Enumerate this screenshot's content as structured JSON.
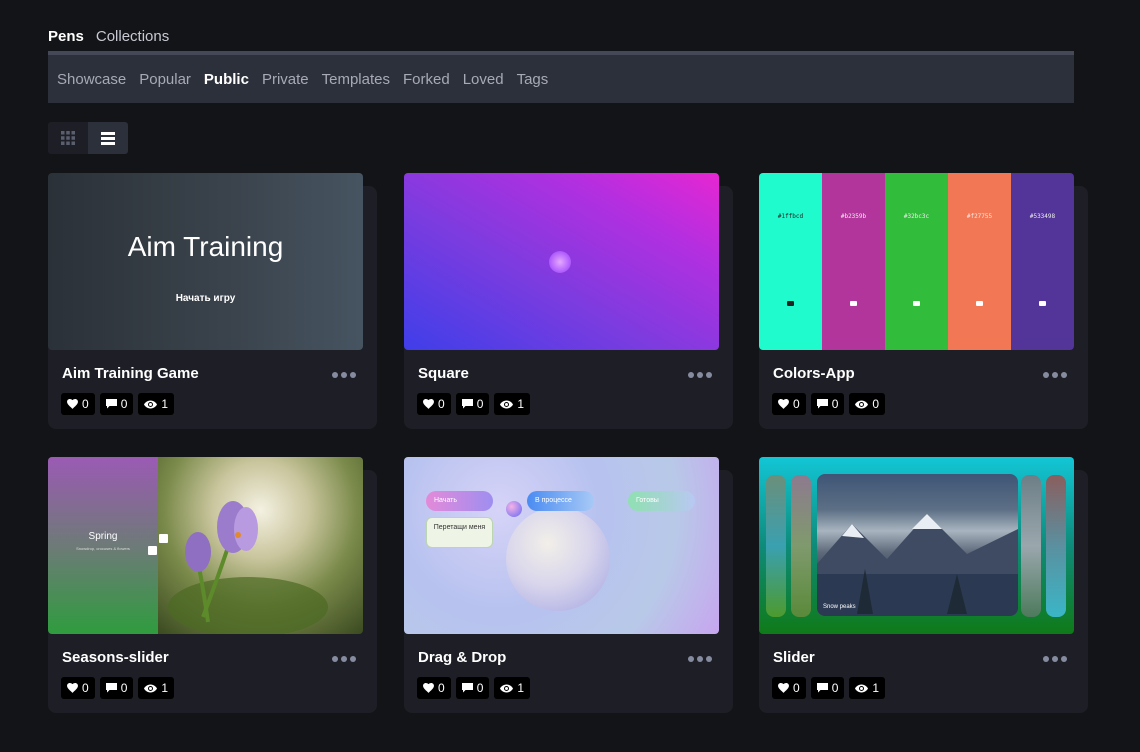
{
  "top_tabs": [
    {
      "label": "Pens",
      "active": true
    },
    {
      "label": "Collections",
      "active": false
    }
  ],
  "sub_tabs": [
    {
      "label": "Showcase"
    },
    {
      "label": "Popular"
    },
    {
      "label": "Public",
      "active": true
    },
    {
      "label": "Private"
    },
    {
      "label": "Templates"
    },
    {
      "label": "Forked"
    },
    {
      "label": "Loved"
    },
    {
      "label": "Tags"
    }
  ],
  "view_toggle": {
    "grid_icon": "grid-icon",
    "list_icon": "list-icon",
    "selected": "list"
  },
  "cards": [
    {
      "title": "Aim Training Game",
      "likes": "0",
      "comments": "0",
      "views": "1",
      "thumb": {
        "heading": "Aim Training",
        "button": "Начать игру"
      }
    },
    {
      "title": "Square",
      "likes": "0",
      "comments": "0",
      "views": "1"
    },
    {
      "title": "Colors-App",
      "likes": "0",
      "comments": "0",
      "views": "0",
      "thumb": {
        "swatches": [
          "#1ffbcd",
          "#b2359b",
          "#32bc3c",
          "#f27755",
          "#533498"
        ],
        "swatch_colors": [
          "#1ffbcd",
          "#b2359b",
          "#32bc3c",
          "#f27755",
          "#533498"
        ]
      }
    },
    {
      "title": "Seasons-slider",
      "likes": "0",
      "comments": "0",
      "views": "1",
      "thumb": {
        "heading": "Spring",
        "subtitle": "Snowdrop, crocuses & flowers"
      }
    },
    {
      "title": "Drag & Drop",
      "likes": "0",
      "comments": "0",
      "views": "1",
      "thumb": {
        "pill1": "Начать",
        "pill2": "В процессе",
        "pill3": "Готовы",
        "draggable": "Перетащи меня"
      }
    },
    {
      "title": "Slider",
      "likes": "0",
      "comments": "0",
      "views": "1",
      "thumb": {
        "caption": "Snow peaks"
      }
    }
  ],
  "colors": {
    "background": "#131417",
    "card": "#1e1f26",
    "tab_bar": "#2c303a",
    "accent_line": "#444857"
  }
}
